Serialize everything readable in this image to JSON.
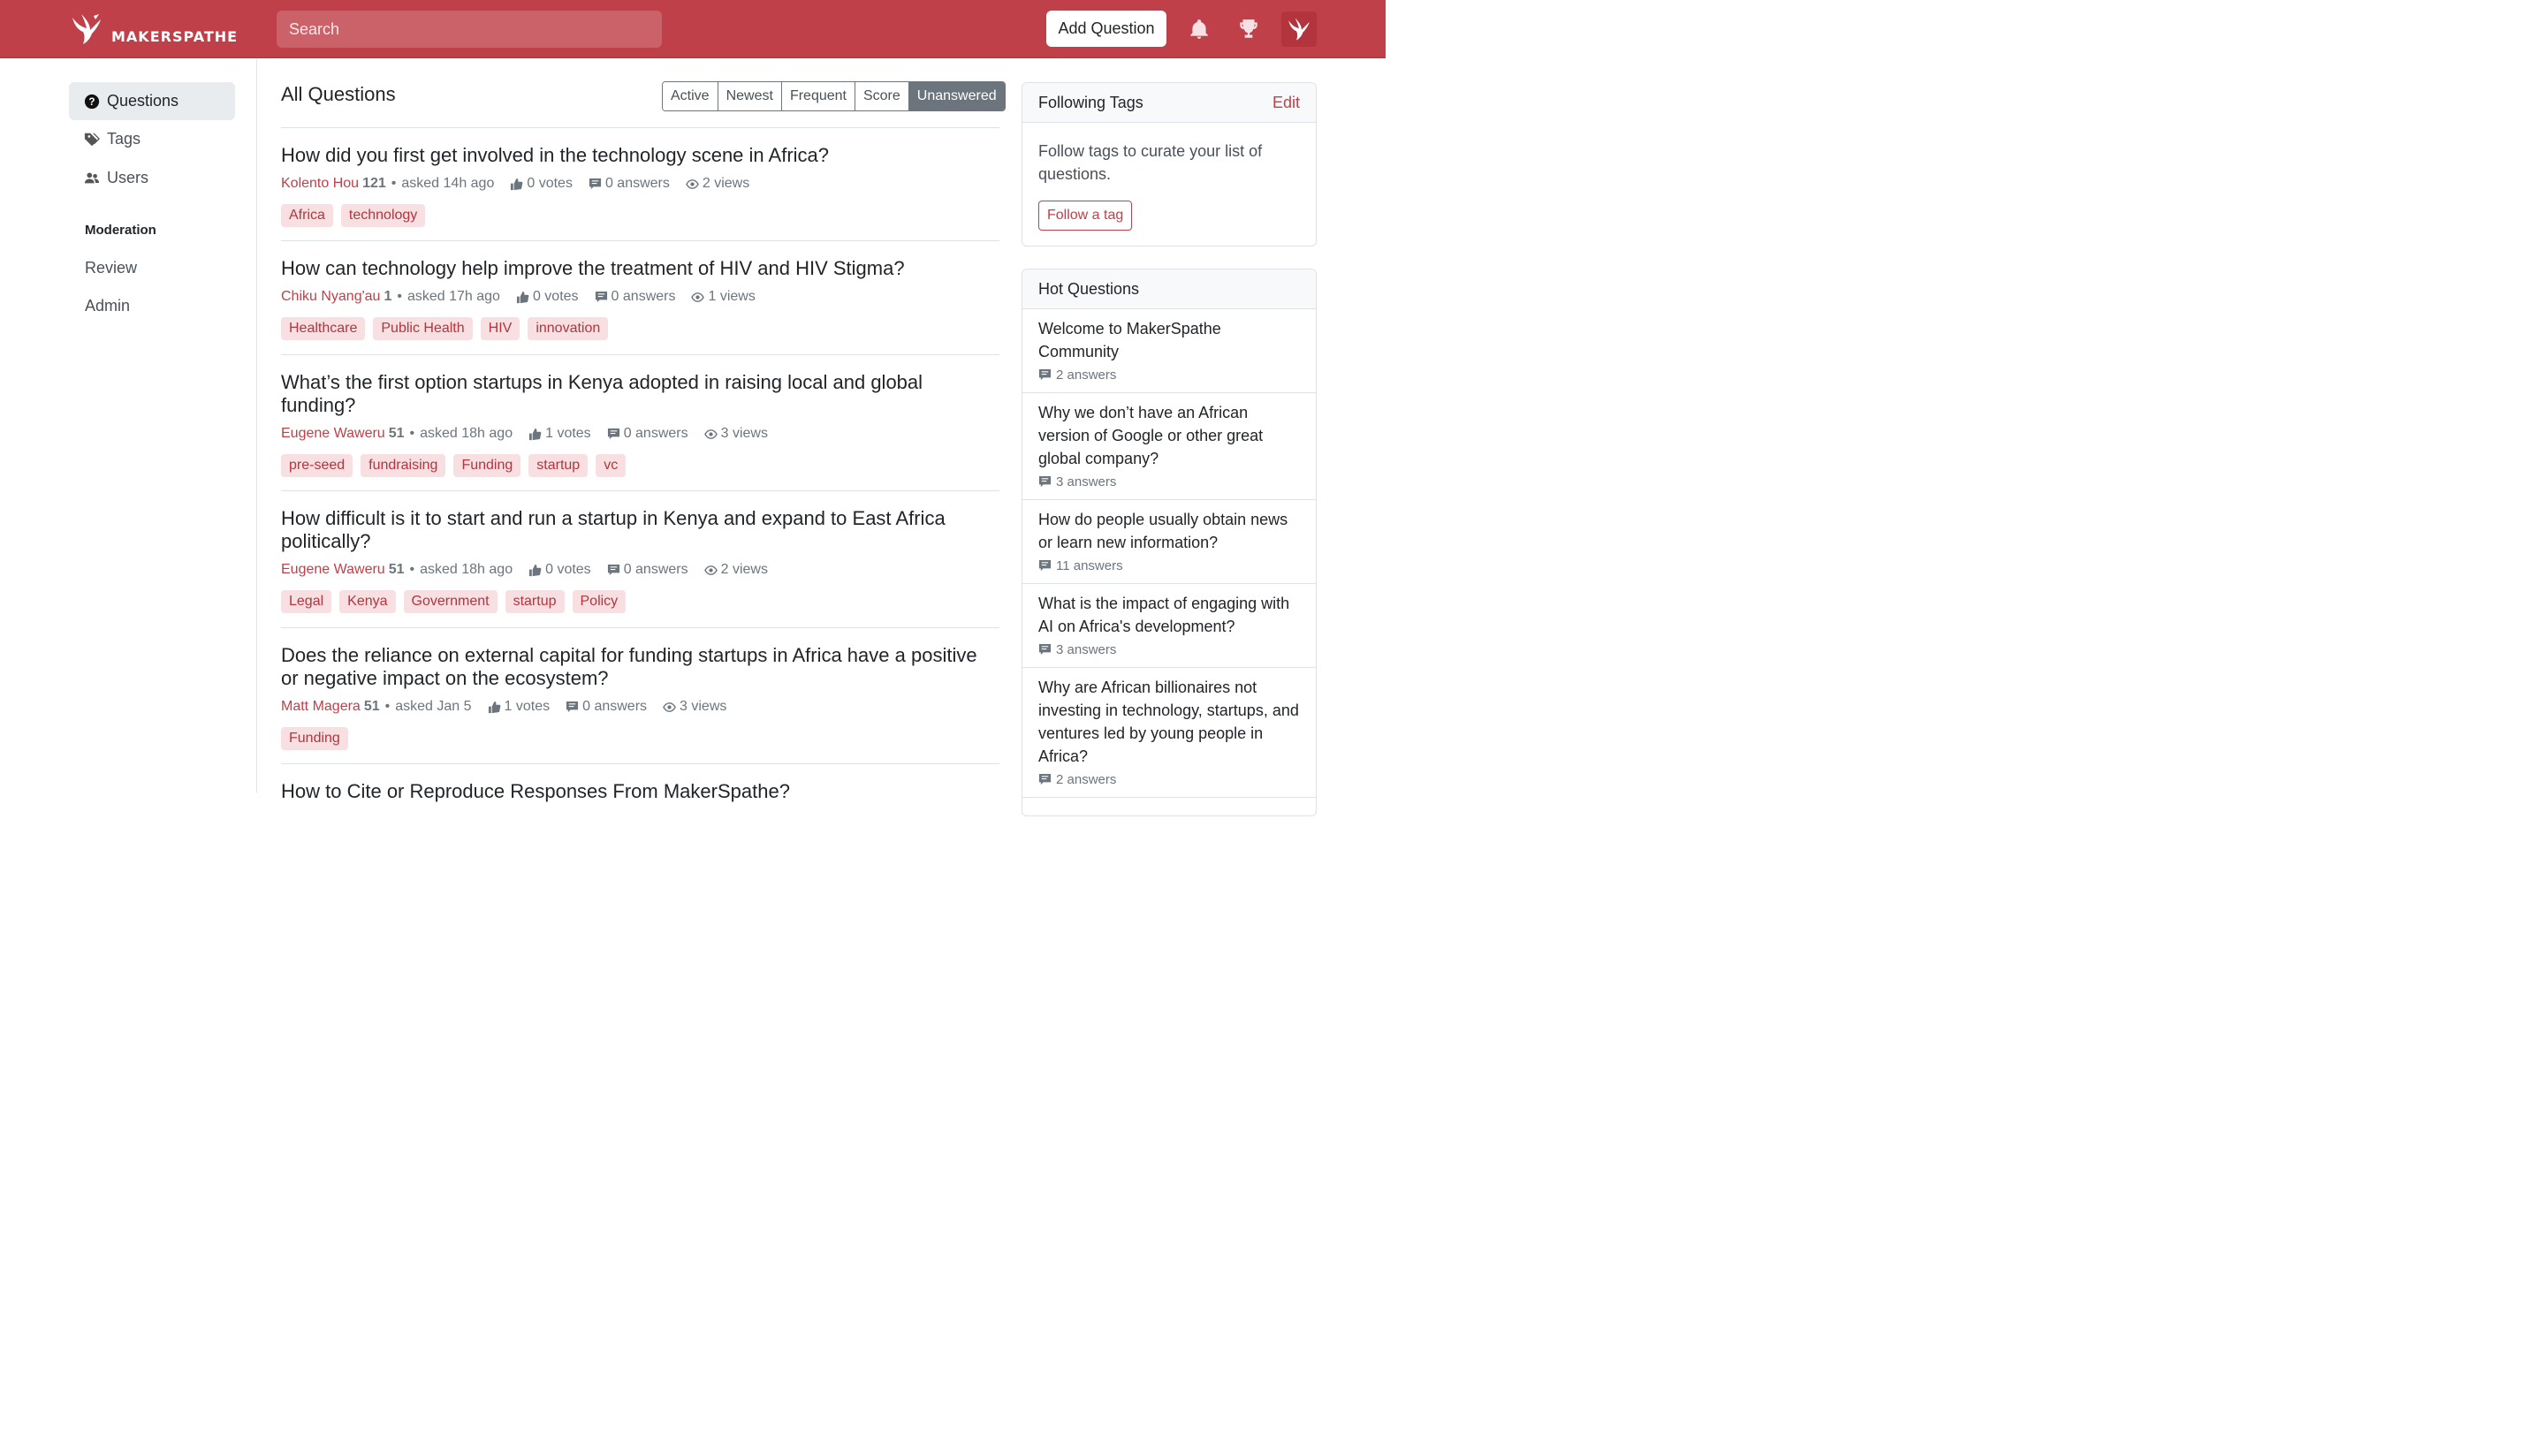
{
  "header": {
    "logo_text": "MAKERSPATHE",
    "search_placeholder": "Search",
    "add_question_label": "Add Question",
    "brand_color": "#c0404a"
  },
  "sidebar": {
    "items": [
      {
        "label": "Questions",
        "icon": "question-circle-icon",
        "active": true
      },
      {
        "label": "Tags",
        "icon": "tags-icon"
      },
      {
        "label": "Users",
        "icon": "users-icon"
      }
    ],
    "moderation_heading": "Moderation",
    "moderation_links": [
      "Review",
      "Admin"
    ]
  },
  "main": {
    "title": "All Questions",
    "filters": [
      "Active",
      "Newest",
      "Frequent",
      "Score",
      "Unanswered"
    ],
    "active_filter": "Unanswered",
    "questions": [
      {
        "title": "How did you first get involved in the technology scene in Africa?",
        "author": "Kolento Hou",
        "rep": "121",
        "asked": "asked 14h ago",
        "votes": "0 votes",
        "answers": "0 answers",
        "views": "2 views",
        "tags": [
          "Africa",
          "technology"
        ]
      },
      {
        "title": "How can technology help improve the treatment of HIV and HIV Stigma?",
        "author": "Chiku Nyang'au",
        "rep": "1",
        "asked": "asked 17h ago",
        "votes": "0 votes",
        "answers": "0 answers",
        "views": "1 views",
        "tags": [
          "Healthcare",
          "Public Health",
          "HIV",
          "innovation"
        ]
      },
      {
        "title": "What’s the first option startups in Kenya adopted in raising local and global funding?",
        "author": "Eugene Waweru",
        "rep": "51",
        "asked": "asked 18h ago",
        "votes": "1 votes",
        "answers": "0 answers",
        "views": "3 views",
        "tags": [
          "pre-seed",
          "fundraising",
          "Funding",
          "startup",
          "vc"
        ]
      },
      {
        "title": "How difficult is it to start and run a startup in Kenya and expand to East Africa politically?",
        "author": "Eugene Waweru",
        "rep": "51",
        "asked": "asked 18h ago",
        "votes": "0 votes",
        "answers": "0 answers",
        "views": "2 views",
        "tags": [
          "Legal",
          "Kenya",
          "Government",
          "startup",
          "Policy"
        ]
      },
      {
        "title": "Does the reliance on external capital for funding startups in Africa have a positive or negative impact on the ecosystem?",
        "author": "Matt Magera",
        "rep": "51",
        "asked": "asked Jan 5",
        "votes": "1 votes",
        "answers": "0 answers",
        "views": "3 views",
        "tags": [
          "Funding"
        ]
      },
      {
        "title": "How to Cite or Reproduce Responses From MakerSpathe?",
        "author": "",
        "rep": "",
        "asked": "",
        "votes": "",
        "answers": "",
        "views": "",
        "tags": []
      }
    ]
  },
  "following_tags": {
    "heading": "Following Tags",
    "edit_label": "Edit",
    "body": "Follow tags to curate your list of questions.",
    "button_label": "Follow a tag"
  },
  "hot_questions": {
    "heading": "Hot Questions",
    "items": [
      {
        "title": "Welcome to MakerSpathe Community",
        "answers": "2 answers"
      },
      {
        "title": "Why we don’t have an African version of Google or other great global company?",
        "answers": "3 answers"
      },
      {
        "title": "How do people usually obtain news or learn new information?",
        "answers": "11 answers"
      },
      {
        "title": "What is the impact of engaging with AI on Africa's development?",
        "answers": "3 answers"
      },
      {
        "title": "Why are African billionaires not investing in technology, startups, and ventures led by young people in Africa?",
        "answers": "2 answers"
      }
    ]
  }
}
